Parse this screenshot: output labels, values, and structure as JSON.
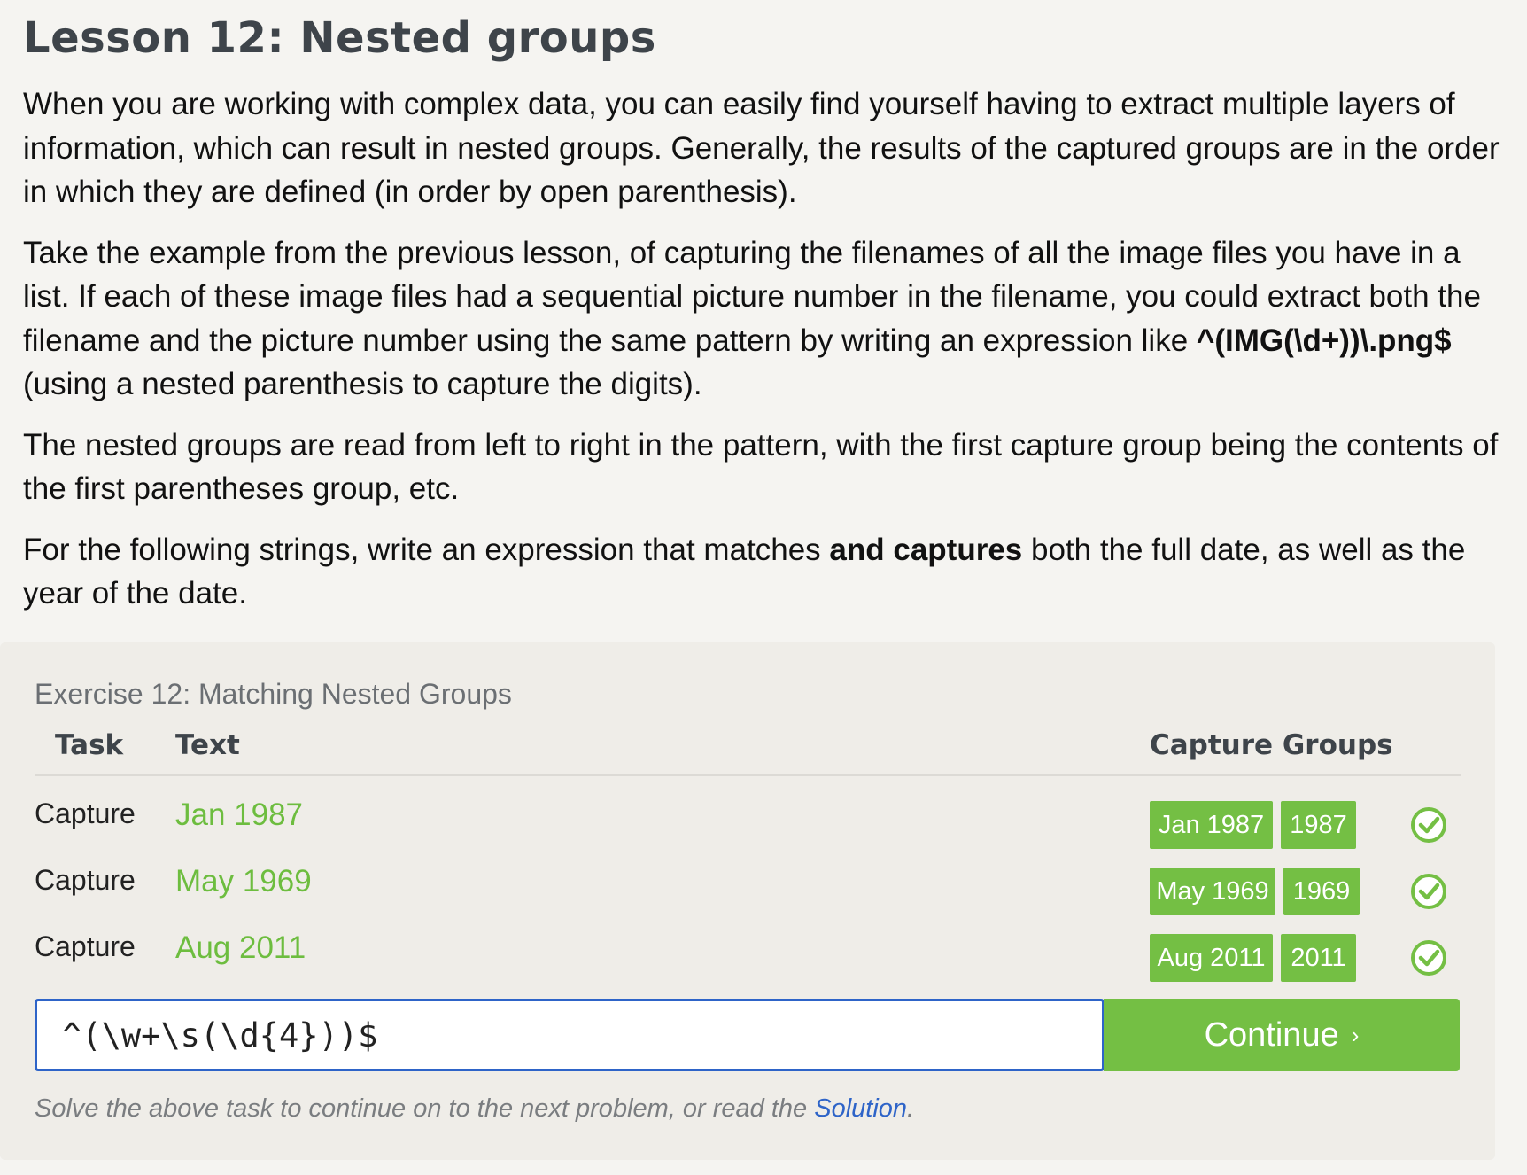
{
  "lesson": {
    "title": "Lesson 12: Nested groups",
    "p1": "When you are working with complex data, you can easily find yourself having to extract multiple layers of information, which can result in nested groups. Generally, the results of the captured groups are in the order in which they are defined (in order by open parenthesis).",
    "p2_before": "Take the example from the previous lesson, of capturing the filenames of all the image files you have in a list. If each of these image files had a sequential picture number in the filename, you could extract both the filename and the picture number using the same pattern by writing an expression like ",
    "p2_code": "^(IMG(\\d+))\\.png$",
    "p2_after": " (using a nested parenthesis to capture the digits).",
    "p3": "The nested groups are read from left to right in the pattern, with the first capture group being the contents of the first parentheses group, etc.",
    "p4_before": "For the following strings, write an expression that matches ",
    "p4_bold": "and captures",
    "p4_after": " both the full date, as well as the year of the date."
  },
  "exercise": {
    "title": "Exercise 12: Matching Nested Groups",
    "headers": {
      "task": "Task",
      "text": "Text",
      "groups": "Capture Groups"
    },
    "rows": [
      {
        "task": "Capture",
        "text": "Jan 1987",
        "groups": [
          "Jan 1987",
          "1987"
        ],
        "status": "check-circle-icon"
      },
      {
        "task": "Capture",
        "text": "May 1969",
        "groups": [
          "May 1969",
          "1969"
        ],
        "status": "check-circle-icon"
      },
      {
        "task": "Capture",
        "text": "Aug 2011",
        "groups": [
          "Aug 2011",
          "2011"
        ],
        "status": "check-circle-icon"
      }
    ],
    "input_value": "^(\\w+\\s(\\d{4}))$",
    "continue_label": "Continue",
    "continue_arrow": "›",
    "hint_before": "Solve the above task to continue on to the next problem, or read the ",
    "hint_link": "Solution",
    "hint_after": "."
  },
  "colors": {
    "accent_green": "#74bf44",
    "text_green": "#6dbd3f",
    "link_blue": "#2e64c8",
    "heading": "#3e444a"
  }
}
